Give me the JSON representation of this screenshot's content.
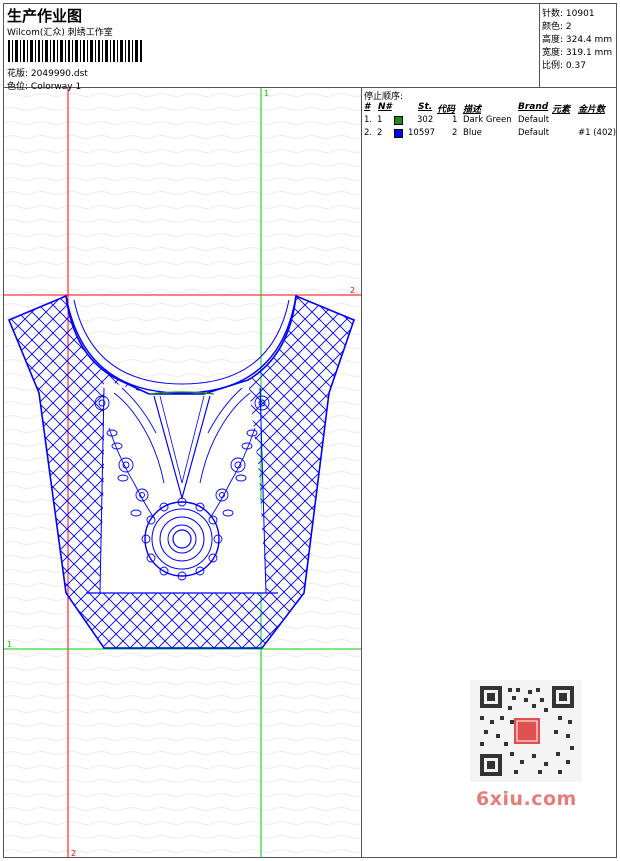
{
  "header": {
    "title": "生产作业图",
    "company": "Wilcom(汇众) 刺绣工作室",
    "design_label": "花版:",
    "design_value": "2049990.dst",
    "colorway_label": "色位:",
    "colorway_value": "Colorway 1"
  },
  "stats": {
    "stitches_label": "针数:",
    "stitches_value": "10901",
    "colors_label": "颜色:",
    "colors_value": "2",
    "height_label": "高度:",
    "height_value": "324.4 mm",
    "width_label": "宽度:",
    "width_value": "319.1 mm",
    "scale_label": "比例:",
    "scale_value": "0.37"
  },
  "stop_sequence": {
    "title": "停止顺序:",
    "columns": [
      "#",
      "N#",
      "St.",
      "代码",
      "描述",
      "Brand",
      "元素",
      "金片数"
    ],
    "rows": [
      {
        "idx": "1.",
        "n": "1",
        "color": "#1a8a1a",
        "st": "302",
        "code": "1",
        "desc": "Dark Green",
        "brand": "Default",
        "element": "",
        "sequin": ""
      },
      {
        "idx": "2.",
        "n": "2",
        "color": "#0000ff",
        "st": "10597",
        "code": "2",
        "desc": "Blue",
        "brand": "Default",
        "element": "",
        "sequin": "#1 (402)"
      }
    ]
  },
  "guides": {
    "v_green_label_top": "1",
    "h_red_label_right": "2",
    "h_green_label_left": "1",
    "v_red_label_bottom": "2",
    "red_color": "#ff0000",
    "green_color": "#00cc00",
    "stitch_color": "#0000ff"
  },
  "watermark": "6xiu.com"
}
